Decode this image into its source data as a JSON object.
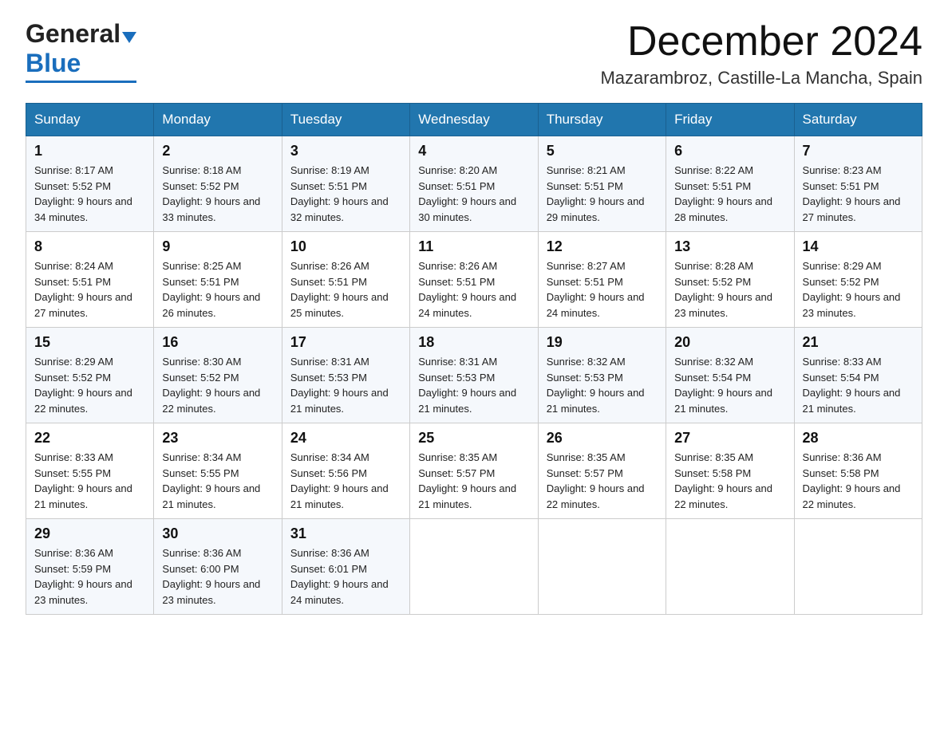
{
  "header": {
    "logo_general": "General",
    "logo_blue": "Blue",
    "month_title": "December 2024",
    "subtitle": "Mazarambroz, Castille-La Mancha, Spain"
  },
  "weekdays": [
    "Sunday",
    "Monday",
    "Tuesday",
    "Wednesday",
    "Thursday",
    "Friday",
    "Saturday"
  ],
  "weeks": [
    [
      {
        "day": "1",
        "sunrise": "8:17 AM",
        "sunset": "5:52 PM",
        "daylight": "9 hours and 34 minutes."
      },
      {
        "day": "2",
        "sunrise": "8:18 AM",
        "sunset": "5:52 PM",
        "daylight": "9 hours and 33 minutes."
      },
      {
        "day": "3",
        "sunrise": "8:19 AM",
        "sunset": "5:51 PM",
        "daylight": "9 hours and 32 minutes."
      },
      {
        "day": "4",
        "sunrise": "8:20 AM",
        "sunset": "5:51 PM",
        "daylight": "9 hours and 30 minutes."
      },
      {
        "day": "5",
        "sunrise": "8:21 AM",
        "sunset": "5:51 PM",
        "daylight": "9 hours and 29 minutes."
      },
      {
        "day": "6",
        "sunrise": "8:22 AM",
        "sunset": "5:51 PM",
        "daylight": "9 hours and 28 minutes."
      },
      {
        "day": "7",
        "sunrise": "8:23 AM",
        "sunset": "5:51 PM",
        "daylight": "9 hours and 27 minutes."
      }
    ],
    [
      {
        "day": "8",
        "sunrise": "8:24 AM",
        "sunset": "5:51 PM",
        "daylight": "9 hours and 27 minutes."
      },
      {
        "day": "9",
        "sunrise": "8:25 AM",
        "sunset": "5:51 PM",
        "daylight": "9 hours and 26 minutes."
      },
      {
        "day": "10",
        "sunrise": "8:26 AM",
        "sunset": "5:51 PM",
        "daylight": "9 hours and 25 minutes."
      },
      {
        "day": "11",
        "sunrise": "8:26 AM",
        "sunset": "5:51 PM",
        "daylight": "9 hours and 24 minutes."
      },
      {
        "day": "12",
        "sunrise": "8:27 AM",
        "sunset": "5:51 PM",
        "daylight": "9 hours and 24 minutes."
      },
      {
        "day": "13",
        "sunrise": "8:28 AM",
        "sunset": "5:52 PM",
        "daylight": "9 hours and 23 minutes."
      },
      {
        "day": "14",
        "sunrise": "8:29 AM",
        "sunset": "5:52 PM",
        "daylight": "9 hours and 23 minutes."
      }
    ],
    [
      {
        "day": "15",
        "sunrise": "8:29 AM",
        "sunset": "5:52 PM",
        "daylight": "9 hours and 22 minutes."
      },
      {
        "day": "16",
        "sunrise": "8:30 AM",
        "sunset": "5:52 PM",
        "daylight": "9 hours and 22 minutes."
      },
      {
        "day": "17",
        "sunrise": "8:31 AM",
        "sunset": "5:53 PM",
        "daylight": "9 hours and 21 minutes."
      },
      {
        "day": "18",
        "sunrise": "8:31 AM",
        "sunset": "5:53 PM",
        "daylight": "9 hours and 21 minutes."
      },
      {
        "day": "19",
        "sunrise": "8:32 AM",
        "sunset": "5:53 PM",
        "daylight": "9 hours and 21 minutes."
      },
      {
        "day": "20",
        "sunrise": "8:32 AM",
        "sunset": "5:54 PM",
        "daylight": "9 hours and 21 minutes."
      },
      {
        "day": "21",
        "sunrise": "8:33 AM",
        "sunset": "5:54 PM",
        "daylight": "9 hours and 21 minutes."
      }
    ],
    [
      {
        "day": "22",
        "sunrise": "8:33 AM",
        "sunset": "5:55 PM",
        "daylight": "9 hours and 21 minutes."
      },
      {
        "day": "23",
        "sunrise": "8:34 AM",
        "sunset": "5:55 PM",
        "daylight": "9 hours and 21 minutes."
      },
      {
        "day": "24",
        "sunrise": "8:34 AM",
        "sunset": "5:56 PM",
        "daylight": "9 hours and 21 minutes."
      },
      {
        "day": "25",
        "sunrise": "8:35 AM",
        "sunset": "5:57 PM",
        "daylight": "9 hours and 21 minutes."
      },
      {
        "day": "26",
        "sunrise": "8:35 AM",
        "sunset": "5:57 PM",
        "daylight": "9 hours and 22 minutes."
      },
      {
        "day": "27",
        "sunrise": "8:35 AM",
        "sunset": "5:58 PM",
        "daylight": "9 hours and 22 minutes."
      },
      {
        "day": "28",
        "sunrise": "8:36 AM",
        "sunset": "5:58 PM",
        "daylight": "9 hours and 22 minutes."
      }
    ],
    [
      {
        "day": "29",
        "sunrise": "8:36 AM",
        "sunset": "5:59 PM",
        "daylight": "9 hours and 23 minutes."
      },
      {
        "day": "30",
        "sunrise": "8:36 AM",
        "sunset": "6:00 PM",
        "daylight": "9 hours and 23 minutes."
      },
      {
        "day": "31",
        "sunrise": "8:36 AM",
        "sunset": "6:01 PM",
        "daylight": "9 hours and 24 minutes."
      },
      null,
      null,
      null,
      null
    ]
  ]
}
